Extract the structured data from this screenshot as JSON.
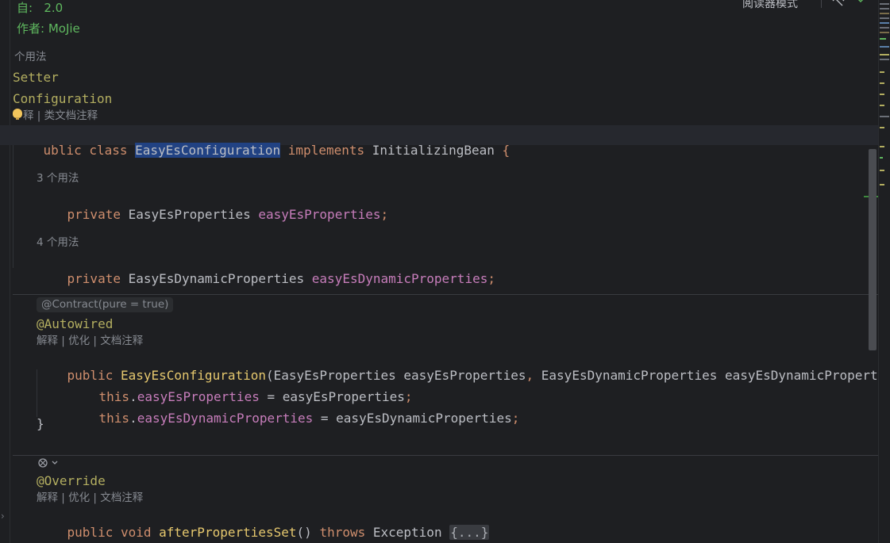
{
  "doc": {
    "version_line": "自:   2.0",
    "author_line": "作者: MoJie"
  },
  "hints": {
    "class_usages": "个用法",
    "class_actions": "释 | 类文档注释",
    "field1_usages": "3 个用法",
    "field2_usages": "4 个用法",
    "contract": "@Contract(pure = true)",
    "ctor_actions": "解释 | 优化 | 文档注释",
    "method_actions": "解释 | 优化 | 文档注释"
  },
  "code": {
    "ann_setter": "Setter",
    "ann_configuration": "Configuration",
    "class_kw": "ublic class ",
    "class_name": "EasyEsConfiguration",
    "implements_kw": " implements ",
    "interface_name": "InitializingBean",
    "open_brace": " {",
    "f1_kw": "private ",
    "f1_type": "EasyEsProperties ",
    "f1_name": "easyEsProperties",
    "f1_semi": ";",
    "f2_kw": "private ",
    "f2_type": "EasyEsDynamicProperties ",
    "f2_name": "easyEsDynamicProperties",
    "f2_semi": ";",
    "ann_autowired": "@Autowired",
    "ctor_kw": "public ",
    "ctor_name": "EasyEsConfiguration",
    "ctor_params_a": "(EasyEsProperties easyEsProperties",
    "ctor_comma": ", ",
    "ctor_params_b": "EasyEsDynamicProperties easyEsDynamicPropert",
    "this1_kw": "this",
    "this1_dot": ".",
    "this1_field": "easyEsProperties",
    "this1_rest": " = easyEsProperties",
    "this1_semi": ";",
    "this2_kw": "this",
    "this2_dot": ".",
    "this2_field": "easyEsDynamicProperties",
    "this2_rest": " = easyEsDynamicProperties",
    "this2_semi": ";",
    "close_brace": "}",
    "ann_override": "@Override",
    "m_public": "public ",
    "m_void": "void ",
    "m_name": "afterPropertiesSet",
    "m_parens": "() ",
    "m_throws": "throws ",
    "m_exc": "Exception ",
    "m_fold": "{...}"
  },
  "toolbar": {
    "reader_mode": "阅读器模式"
  },
  "icons": {
    "implement_marker": "implementation-marker-icon",
    "eye": "eye-slash-icon",
    "check": "check-icon",
    "bulb": "lightbulb-icon"
  },
  "colors": {
    "background": "#1e1f22",
    "keyword": "#cf8e6d",
    "annotation": "#b3ae60",
    "field": "#c77dbb",
    "method_decl": "#56a8f5",
    "doc_comment": "#5fb85f"
  }
}
